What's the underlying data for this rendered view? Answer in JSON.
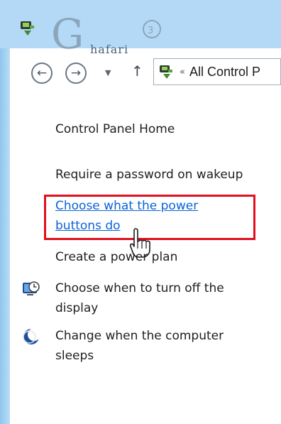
{
  "window": {
    "watermark_text": "hafari"
  },
  "navigation": {
    "back_icon": "back-arrow-icon",
    "forward_icon": "forward-arrow-icon",
    "recent_icon": "dropdown-chevron-icon",
    "up_icon": "up-arrow-icon",
    "address_chevron": "«",
    "address_text": "All Control P"
  },
  "sidebar": {
    "home_link": "Control Panel Home",
    "links": [
      {
        "label": "Require a password on wakeup",
        "style": "normal"
      },
      {
        "label_line1": "Choose what the power",
        "label_line2": "buttons do",
        "style": "hyperlink"
      },
      {
        "label": "Create a power plan",
        "style": "normal"
      },
      {
        "label_line1": "Choose when to turn off the",
        "label_line2": "display",
        "icon": "display-clock-icon"
      },
      {
        "label_line1": "Change when the computer",
        "label_line2": "sleeps",
        "icon": "sleep-moon-icon"
      }
    ]
  },
  "colors": {
    "highlight_border": "#e0101e",
    "hyperlink": "#0a62d8",
    "titlebar": "#b3d9f6"
  }
}
